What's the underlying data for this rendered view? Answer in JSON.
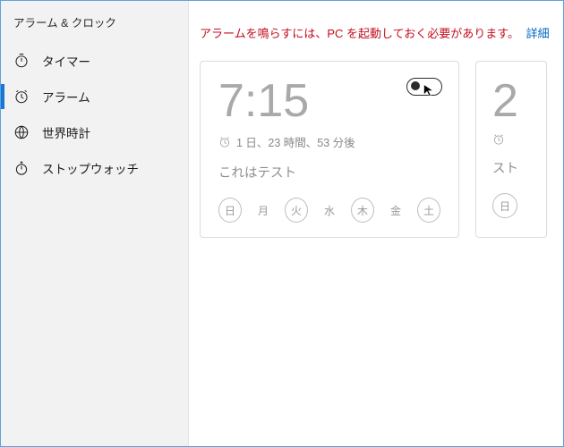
{
  "app_title": "アラーム & クロック",
  "sidebar": {
    "items": [
      {
        "label": "タイマー"
      },
      {
        "label": "アラーム"
      },
      {
        "label": "世界時計"
      },
      {
        "label": "ストップウォッチ"
      }
    ]
  },
  "warning": {
    "text": "アラームを鳴らすには、PC を起動しておく必要があります。",
    "link": "詳細"
  },
  "alarm_card": {
    "time": "7:15",
    "countdown": "1 日、23 時間、53 分後",
    "name": "これはテスト",
    "days": [
      {
        "label": "日",
        "selected": true
      },
      {
        "label": "月",
        "selected": false
      },
      {
        "label": "火",
        "selected": true
      },
      {
        "label": "水",
        "selected": false
      },
      {
        "label": "木",
        "selected": true
      },
      {
        "label": "金",
        "selected": false
      },
      {
        "label": "土",
        "selected": true
      }
    ],
    "enabled": false
  },
  "alarm_card2": {
    "time_fragment": "2",
    "name_fragment": "スト",
    "day_fragment": "日"
  }
}
